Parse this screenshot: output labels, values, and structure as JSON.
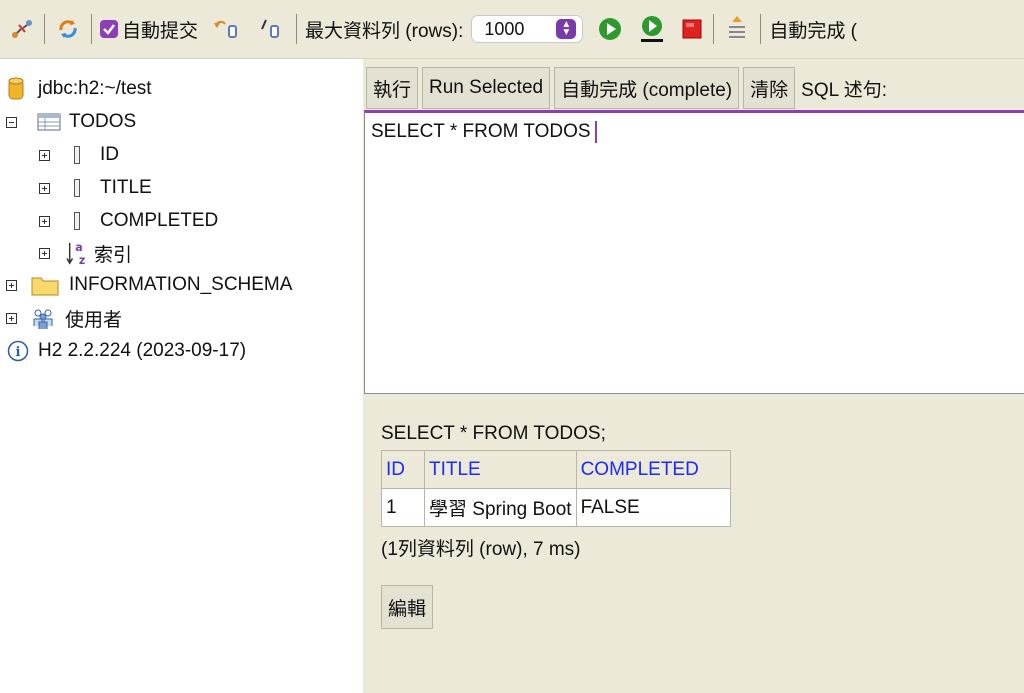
{
  "toolbar": {
    "auto_commit_label": "自動提交",
    "max_rows_label": "最大資料列 (rows):",
    "max_rows_value": "1000",
    "auto_complete_label": "自動完成 (",
    "accent_color": "#8b3fb2",
    "icons": [
      "disconnect-icon",
      "refresh-icon",
      "auto-commit-checkbox",
      "rollback-icon",
      "commit-icon",
      "run-icon",
      "run-selected-icon",
      "stop-icon",
      "history-icon"
    ]
  },
  "tree": {
    "connection": "jdbc:h2:~/test",
    "table_name": "TODOS",
    "columns": [
      "ID",
      "TITLE",
      "COMPLETED"
    ],
    "indexes_label": "索引",
    "schema": "INFORMATION_SCHEMA",
    "users": "使用者",
    "version": "H2 2.2.224 (2023-09-17)"
  },
  "query": {
    "buttons": {
      "execute": "執行",
      "run_selected": "Run Selected",
      "auto_complete": "自動完成 (complete)",
      "clear": "清除"
    },
    "sql_label": "SQL 述句:",
    "sql_text": "SELECT * FROM TODOS"
  },
  "result": {
    "query": "SELECT * FROM TODOS;",
    "headers": [
      "ID",
      "TITLE",
      "COMPLETED"
    ],
    "rows": [
      [
        "1",
        "學習 Spring Boot",
        "FALSE"
      ]
    ],
    "summary": "(1列資料列 (row), 7 ms)",
    "edit_label": "編輯"
  }
}
